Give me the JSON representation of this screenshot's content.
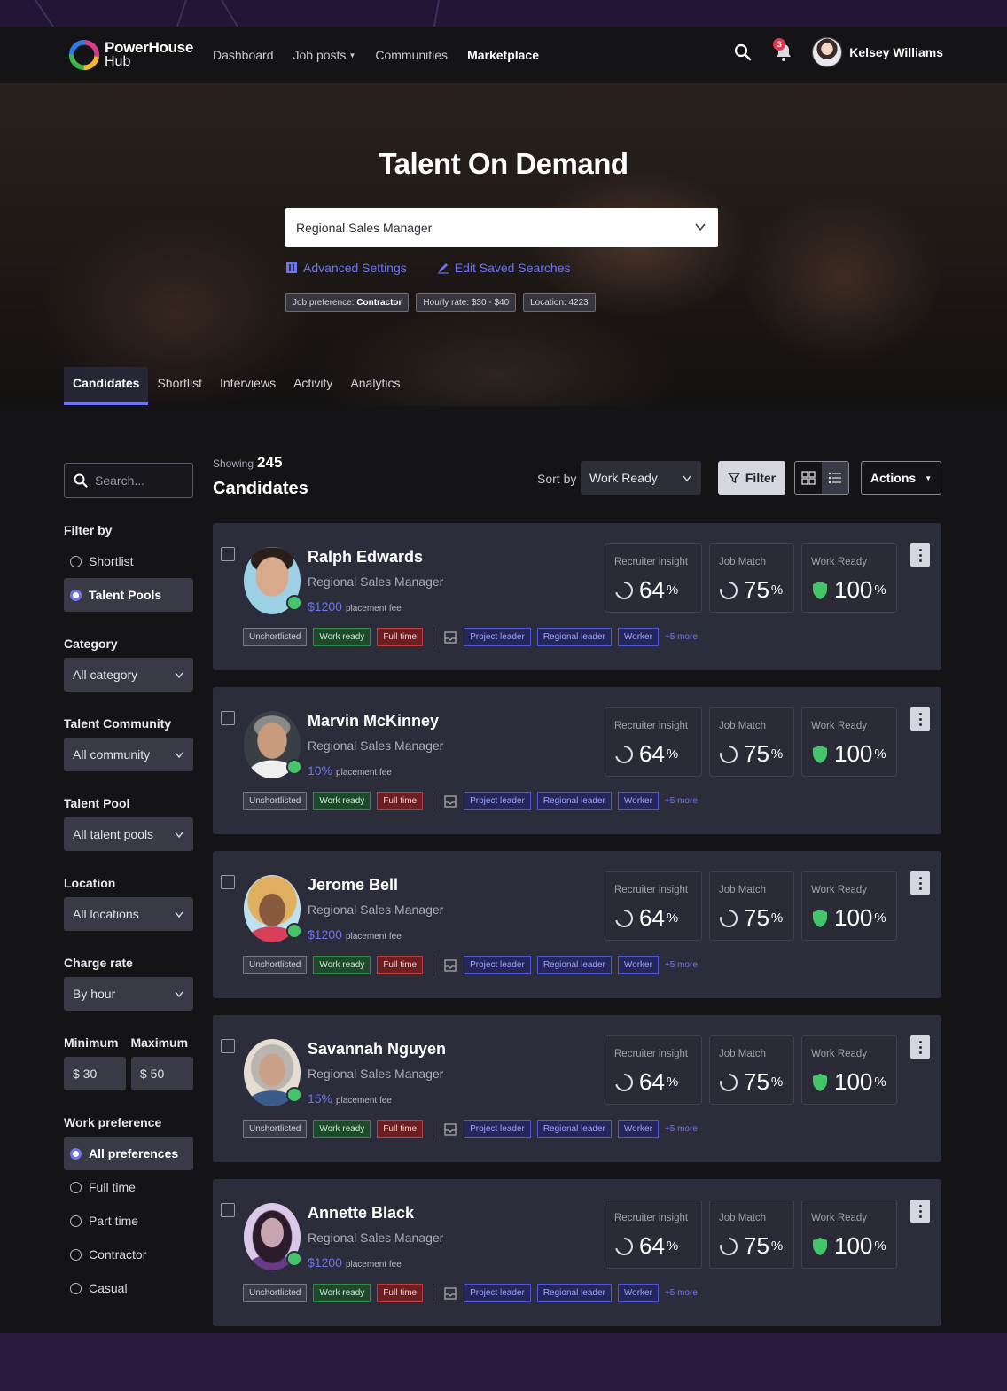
{
  "app": {
    "logo_line1": "PowerHouse",
    "logo_line2": "Hub"
  },
  "nav": {
    "links": [
      "Dashboard",
      "Job posts",
      "Communities",
      "Marketplace"
    ],
    "notification_count": "3",
    "user_name": "Kelsey Williams"
  },
  "hero": {
    "title": "Talent On Demand",
    "search_value": "Regional Sales Manager",
    "advanced_settings": "Advanced Settings",
    "edit_saved_searches": "Edit Saved Searches",
    "chips": [
      {
        "label": "Job preference:",
        "value": "Contractor"
      },
      {
        "label": "Hourly rate: $30 - $40",
        "value": ""
      },
      {
        "label": "Location: 4223",
        "value": ""
      }
    ],
    "tabs": [
      "Candidates",
      "Shortlist",
      "Interviews",
      "Activity",
      "Analytics"
    ]
  },
  "sidebar": {
    "search_placeholder": "Search...",
    "filter_by_label": "Filter by",
    "filter_by_options": [
      "Shortlist",
      "Talent Pools"
    ],
    "category_label": "Category",
    "category_value": "All category",
    "community_label": "Talent Community",
    "community_value": "All community",
    "pool_label": "Talent Pool",
    "pool_value": "All talent pools",
    "location_label": "Location",
    "location_value": "All locations",
    "charge_label": "Charge rate",
    "charge_value": "By hour",
    "min_label": "Minimum",
    "max_label": "Maximum",
    "min_value": "$ 30",
    "max_value": "$ 50",
    "work_pref_label": "Work preference",
    "work_pref_options": [
      "All preferences",
      "Full time",
      "Part time",
      "Contractor",
      "Casual"
    ]
  },
  "content": {
    "showing_label": "Showing",
    "showing_count": "245",
    "title": "Candidates",
    "sort_label": "Sort by",
    "sort_value": "Work Ready",
    "filter_label": "Filter",
    "actions_label": "Actions"
  },
  "metric_labels": {
    "insight": "Recruiter insight",
    "match": "Job Match",
    "ready": "Work Ready"
  },
  "tag_labels": {
    "status": "Unshortlisted",
    "ready": "Work ready",
    "type": "Full time",
    "skills": [
      "Project leader",
      "Regional leader",
      "Worker"
    ],
    "more": "+5 more"
  },
  "candidates": [
    {
      "name": "Ralph Edwards",
      "role": "Regional Sales Manager",
      "fee": "$1200",
      "fee_suffix": "placement fee",
      "insight": "64",
      "match": "75",
      "ready": "100"
    },
    {
      "name": "Marvin McKinney",
      "role": "Regional Sales Manager",
      "fee": "10%",
      "fee_suffix": "placement fee",
      "insight": "64",
      "match": "75",
      "ready": "100"
    },
    {
      "name": "Jerome Bell",
      "role": "Regional Sales Manager",
      "fee": "$1200",
      "fee_suffix": "placement fee",
      "insight": "64",
      "match": "75",
      "ready": "100"
    },
    {
      "name": "Savannah Nguyen",
      "role": "Regional Sales Manager",
      "fee": "15%",
      "fee_suffix": "placement fee",
      "insight": "64",
      "match": "75",
      "ready": "100"
    },
    {
      "name": "Annette Black",
      "role": "Regional Sales Manager",
      "fee": "$1200",
      "fee_suffix": "placement fee",
      "insight": "64",
      "match": "75",
      "ready": "100"
    }
  ],
  "colors": {
    "accent": "#6d74f0",
    "online": "#45c46a",
    "work_ready_tag": "#1d4a2a",
    "full_time_tag": "#6b1f22",
    "page_bg": "#141416",
    "card_bg": "#2c2d3a"
  }
}
